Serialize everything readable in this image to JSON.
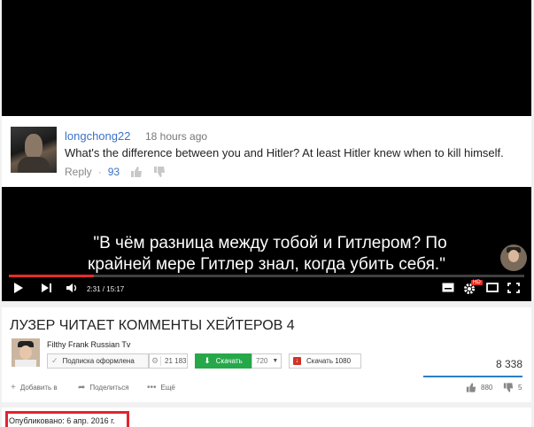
{
  "video": {
    "comment": {
      "author": "longchong22",
      "time": "18 hours ago",
      "text": "What's the difference between you and Hitler? At least Hitler knew when to kill himself.",
      "reply": "Reply",
      "likes": "93"
    },
    "subtitle_line1": "\"В чём разница между тобой и Гитлером? По",
    "subtitle_line2": "крайней мере Гитлер знал, когда убить себя.\"",
    "time_display": "2:31 / 15:17",
    "progress": 0.165,
    "hd_badge": "HD",
    "colors": {
      "progress": "#e52d27",
      "author": "#3a72c9"
    }
  },
  "info": {
    "title": "ЛУЗЕР ЧИТАЕТ КОММЕНТЫ ХЕЙТЕРОВ 4",
    "channel": "Filthy Frank Russian Tv",
    "subscribe_label": "Подписка оформлена",
    "subscriber_count": "21 183",
    "download_label": "Скачать",
    "quality": "720",
    "download2_label": "Скачать 1080",
    "views": "8 338",
    "actions": {
      "add_to": "Добавить в",
      "share": "Поделиться",
      "more": "Ещё"
    },
    "likes": "880",
    "dislikes": "5",
    "colors": {
      "download": "#26a84a",
      "views_bar": "#2b7fc6"
    }
  },
  "published": {
    "text": "Опубликовано: 6 апр. 2016 г.",
    "highlight_color": "#e2232e"
  }
}
